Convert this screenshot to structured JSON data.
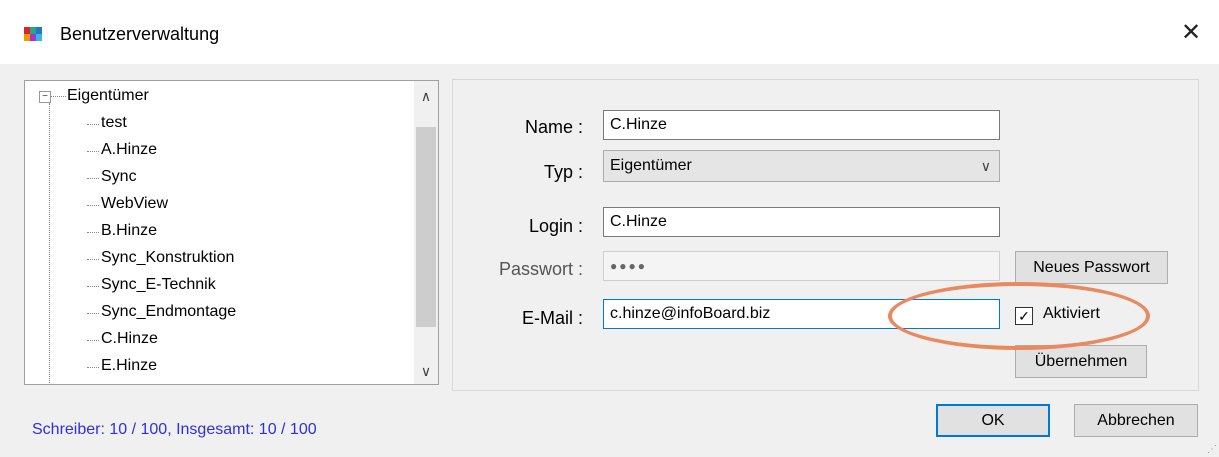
{
  "window": {
    "title": "Benutzerverwaltung",
    "close": "✕"
  },
  "tree": {
    "root": "Eigentümer",
    "root_toggle": "−",
    "children": [
      "test",
      "A.Hinze",
      "Sync",
      "WebView",
      "B.Hinze",
      "Sync_Konstruktion",
      "Sync_E-Technik",
      "Sync_Endmontage",
      "C.Hinze",
      "E.Hinze"
    ],
    "scroll_up": "∧",
    "scroll_down": "∨"
  },
  "status": "Schreiber: 10 / 100, Insgesamt: 10 / 100",
  "form": {
    "name_label": "Name :",
    "name_value": "C.Hinze",
    "typ_label": "Typ :",
    "typ_value": "Eigentümer",
    "login_label": "Login :",
    "login_value": "C.Hinze",
    "passwort_label": "Passwort :",
    "passwort_value": "●●●●",
    "email_label": "E-Mail :",
    "email_value": "c.hinze@infoBoard.biz",
    "neues_passwort": "Neues Passwort",
    "aktiviert_label": "Aktiviert",
    "aktiviert_checked": "✓",
    "uebernehmen": "Übernehmen"
  },
  "buttons": {
    "ok": "OK",
    "abbrechen": "Abbrechen"
  }
}
